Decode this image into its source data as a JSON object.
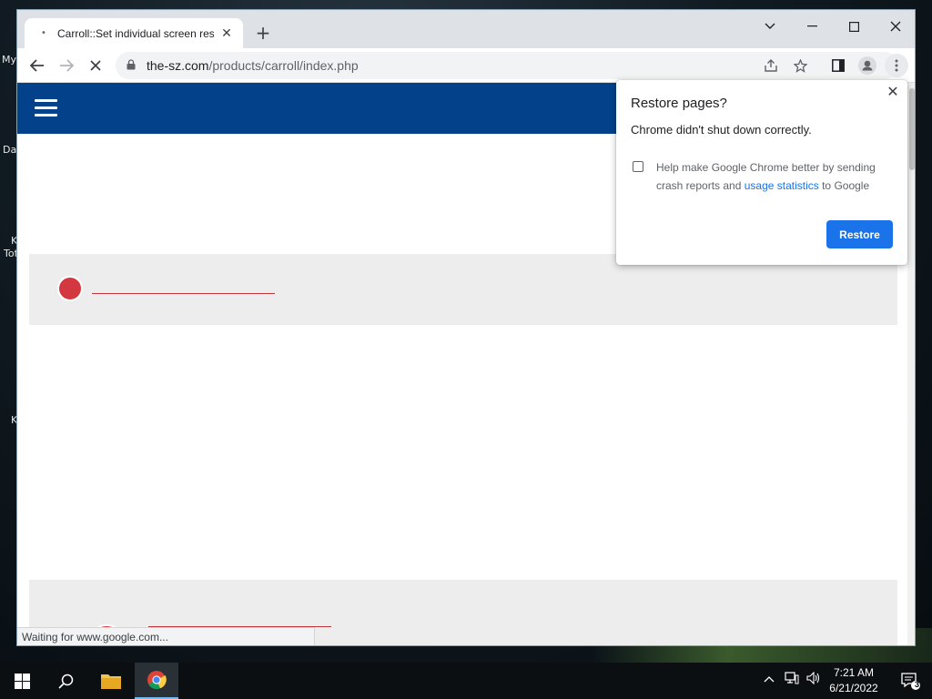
{
  "desktop": {
    "icon_labels": [
      "My",
      "Da",
      "K",
      "Tot",
      "K"
    ]
  },
  "browser": {
    "tab_title": "Carroll::Set individual screen reso",
    "tab_close": "✕",
    "new_tab": "+",
    "url_host": "the-sz.com",
    "url_path": "/products/carroll/index.php",
    "status_text": "Waiting for www.google.com..."
  },
  "popup": {
    "title": "Restore pages?",
    "message": "Chrome didn't shut down correctly.",
    "checkbox_text_before": "Help make Google Chrome better by sending crash reports and ",
    "checkbox_link": "usage statistics",
    "checkbox_text_after": " to Google",
    "restore_label": "Restore",
    "close": "✕"
  },
  "site": {
    "header_color": "#03428a",
    "accent_red": "#d33840"
  },
  "taskbar": {
    "time": "7:21 AM",
    "date": "6/21/2022",
    "notification_count": "3"
  }
}
